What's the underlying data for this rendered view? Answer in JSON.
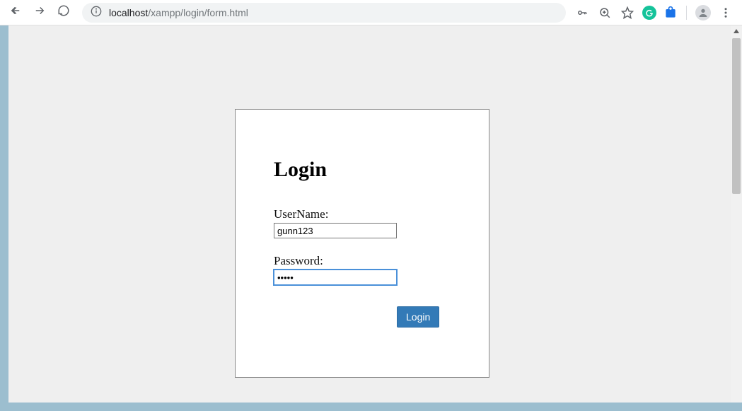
{
  "browser": {
    "url_host": "localhost",
    "url_path": "/xampp/login/form.html"
  },
  "page": {
    "title": "Login",
    "username_label": "UserName:",
    "username_value": "gunn123",
    "password_label": "Password:",
    "password_value": "•••••",
    "login_button": "Login"
  }
}
